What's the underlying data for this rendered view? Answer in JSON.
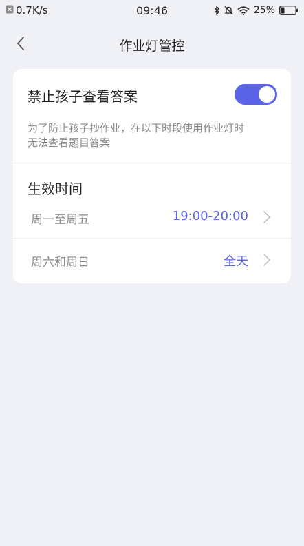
{
  "status_bar": {
    "speed": "0.7K/s",
    "time": "09:46",
    "battery": "25%",
    "battery_level": 0.25
  },
  "nav": {
    "title": "作业灯管控"
  },
  "setting": {
    "label": "禁止孩子查看答案",
    "enabled": true,
    "description_line1": "为了防止孩子抄作业，在以下时段使用作业灯时",
    "description_line2": "无法查看题目答案"
  },
  "effective_time": {
    "title": "生效时间",
    "rows": [
      {
        "label": "周一至周五",
        "value": "19:00-20:00"
      },
      {
        "label": "周六和周日",
        "value": "全天"
      }
    ]
  },
  "colors": {
    "accent": "#5b63e8",
    "background": "#f0f1f7",
    "card": "#ffffff"
  },
  "icons": [
    "close-box-icon",
    "bluetooth-icon",
    "mute-icon",
    "wifi-icon",
    "battery-icon",
    "back-chevron-icon",
    "chevron-right-icon"
  ]
}
